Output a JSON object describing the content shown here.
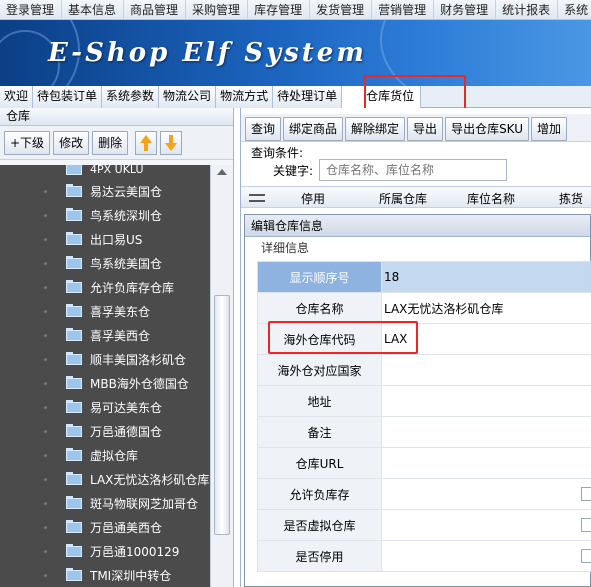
{
  "top_menu": [
    "登录管理",
    "基本信息",
    "商品管理",
    "采购管理",
    "库存管理",
    "发货管理",
    "营销管理",
    "财务管理",
    "统计报表",
    "系统"
  ],
  "banner": {
    "title": "E-Shop Elf System"
  },
  "tabs": [
    {
      "label": "欢迎",
      "active": false
    },
    {
      "label": "待包装订单",
      "active": false
    },
    {
      "label": "系统参数",
      "active": false
    },
    {
      "label": "物流公司",
      "active": false
    },
    {
      "label": "物流方式",
      "active": false
    },
    {
      "label": "待处理订单",
      "active": false
    },
    {
      "label": "仓库货位",
      "active": true
    }
  ],
  "left_panel": {
    "title": "仓库",
    "toolbar": {
      "add_child": "+下级",
      "edit": "修改",
      "delete": "删除"
    },
    "tree_items": [
      "4PX UKLU",
      "易达云美国仓",
      "鸟系统深圳仓",
      "出口易US",
      "鸟系统美国仓",
      "允许负库存仓库",
      "喜孚美东仓",
      "喜孚美西仓",
      "顺丰美国洛杉矶仓",
      "MBB海外仓德国仓",
      "易可达美东仓",
      "万邑通德国仓",
      "虚拟仓库",
      "LAX无忧达洛杉矶仓库",
      "斑马物联网芝加哥仓",
      "万邑通美西仓",
      "万邑通1000129",
      "TMI深圳中转仓"
    ]
  },
  "right_panel": {
    "toolbar": [
      "查询",
      "绑定商品",
      "解除绑定",
      "导出",
      "导出仓库SKU",
      "增加"
    ],
    "query_label": "查询条件:",
    "keyword_label": "关键字:",
    "keyword_placeholder": "仓库名称、库位名称",
    "grid_headers": [
      "停用",
      "所属仓库",
      "库位名称",
      "拣货"
    ]
  },
  "dialog": {
    "title": "编辑仓库信息",
    "section": "详细信息",
    "fields": [
      {
        "label": "显示顺序号",
        "value": "18"
      },
      {
        "label": "仓库名称",
        "value": "LAX无忧达洛杉矶仓库"
      },
      {
        "label": "海外仓库代码",
        "value": "LAX"
      },
      {
        "label": "海外仓对应国家",
        "value": ""
      },
      {
        "label": "地址",
        "value": ""
      },
      {
        "label": "备注",
        "value": ""
      },
      {
        "label": "仓库URL",
        "value": ""
      },
      {
        "label": "允许负库存",
        "value": ""
      },
      {
        "label": "是否虚拟仓库",
        "value": ""
      },
      {
        "label": "是否停用",
        "value": ""
      }
    ]
  },
  "colors": {
    "highlight_box": "#e8282a",
    "tree_bg": "#4b4b4b",
    "selected_row": "#8fb3e0"
  }
}
